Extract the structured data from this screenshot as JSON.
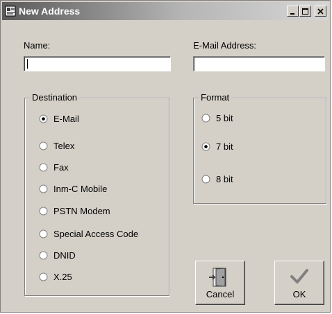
{
  "window": {
    "title": "New Address"
  },
  "fields": {
    "name": {
      "label": "Name:",
      "value": ""
    },
    "email": {
      "label": "E-Mail Address:",
      "value": ""
    }
  },
  "destination": {
    "label": "Destination",
    "options": [
      "E-Mail",
      "Telex",
      "Fax",
      "Inm-C Mobile",
      "PSTN Modem",
      "Special Access Code",
      "DNID",
      "X.25"
    ],
    "selected": "E-Mail"
  },
  "format": {
    "label": "Format",
    "options": [
      "5 bit",
      "7 bit",
      "8 bit"
    ],
    "selected": "7 bit"
  },
  "buttons": {
    "cancel": "Cancel",
    "ok": "OK"
  },
  "icons": {
    "app": "address-book-icon",
    "cancel": "door-exit-icon",
    "ok": "checkmark-icon"
  }
}
